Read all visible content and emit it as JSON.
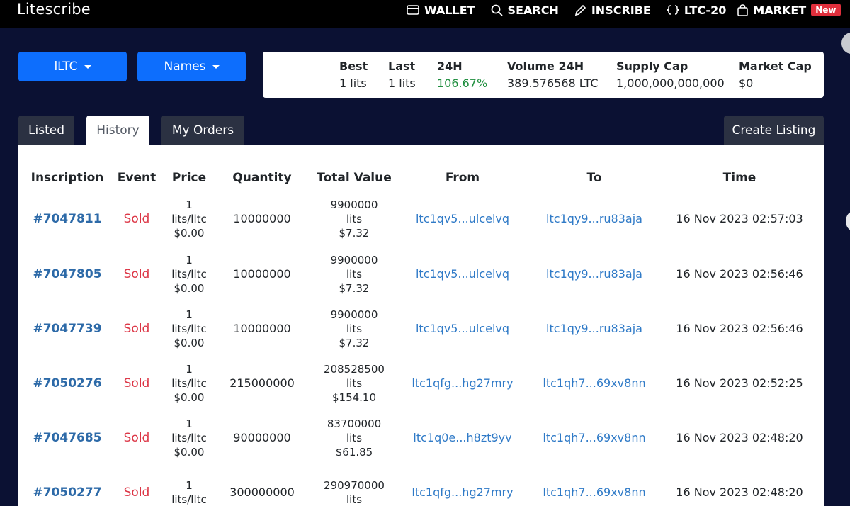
{
  "app": {
    "brand": "Litescribe"
  },
  "nav": {
    "items": [
      {
        "label": "WALLET",
        "icon": "wallet-icon"
      },
      {
        "label": "SEARCH",
        "icon": "search-icon"
      },
      {
        "label": "INSCRIBE",
        "icon": "pencil-icon"
      },
      {
        "label": "LTC-20",
        "icon": "braces-icon"
      },
      {
        "label": "MARKET",
        "icon": "bag-icon",
        "badge": "New"
      }
    ]
  },
  "filters": {
    "token": "lLTC",
    "type": "Names"
  },
  "stats": {
    "best": {
      "label": "Best",
      "value": "1 lits"
    },
    "last": {
      "label": "Last",
      "value": "1 lits"
    },
    "change": {
      "label": "24H",
      "value": "106.67%"
    },
    "volume": {
      "label": "Volume 24H",
      "value": "389.576568 LTC"
    },
    "supply": {
      "label": "Supply Cap",
      "value": "1,000,000,000,000"
    },
    "mcap": {
      "label": "Market Cap",
      "value": "$0"
    }
  },
  "tabs": [
    {
      "label": "Listed"
    },
    {
      "label": "History"
    },
    {
      "label": "My Orders"
    }
  ],
  "actions": {
    "create_listing": "Create Listing"
  },
  "table": {
    "headers": [
      "Inscription",
      "Event",
      "Price",
      "Quantity",
      "Total Value",
      "From",
      "To",
      "Time"
    ],
    "rows": [
      {
        "inscription": "#7047811",
        "event": "Sold",
        "price": "1",
        "price_unit": "lits/lltc",
        "price_usd": "$0.00",
        "quantity": "10000000",
        "total": "9900000",
        "total_unit": "lits",
        "total_usd": "$7.32",
        "from": "ltc1qv5...ulcelvq",
        "to": "ltc1qy9...ru83aja",
        "time": "16 Nov 2023 02:57:03"
      },
      {
        "inscription": "#7047805",
        "event": "Sold",
        "price": "1",
        "price_unit": "lits/lltc",
        "price_usd": "$0.00",
        "quantity": "10000000",
        "total": "9900000",
        "total_unit": "lits",
        "total_usd": "$7.32",
        "from": "ltc1qv5...ulcelvq",
        "to": "ltc1qy9...ru83aja",
        "time": "16 Nov 2023 02:56:46"
      },
      {
        "inscription": "#7047739",
        "event": "Sold",
        "price": "1",
        "price_unit": "lits/lltc",
        "price_usd": "$0.00",
        "quantity": "10000000",
        "total": "9900000",
        "total_unit": "lits",
        "total_usd": "$7.32",
        "from": "ltc1qv5...ulcelvq",
        "to": "ltc1qy9...ru83aja",
        "time": "16 Nov 2023 02:56:46"
      },
      {
        "inscription": "#7050276",
        "event": "Sold",
        "price": "1",
        "price_unit": "lits/lltc",
        "price_usd": "$0.00",
        "quantity": "215000000",
        "total": "208528500",
        "total_unit": "lits",
        "total_usd": "$154.10",
        "from": "ltc1qfg...hg27mry",
        "to": "ltc1qh7...69xv8nn",
        "time": "16 Nov 2023 02:52:25"
      },
      {
        "inscription": "#7047685",
        "event": "Sold",
        "price": "1",
        "price_unit": "lits/lltc",
        "price_usd": "$0.00",
        "quantity": "90000000",
        "total": "83700000",
        "total_unit": "lits",
        "total_usd": "$61.85",
        "from": "ltc1q0e...h8zt9yv",
        "to": "ltc1qh7...69xv8nn",
        "time": "16 Nov 2023 02:48:20"
      },
      {
        "inscription": "#7050277",
        "event": "Sold",
        "price": "1",
        "price_unit": "lits/lltc",
        "price_usd": "",
        "quantity": "300000000",
        "total": "290970000",
        "total_unit": "lits",
        "total_usd": "",
        "from": "ltc1qfg...hg27mry",
        "to": "ltc1qh7...69xv8nn",
        "time": "16 Nov 2023 02:48:20"
      }
    ]
  },
  "colors": {
    "background": "#0b1133",
    "primary": "#0d6efd",
    "positive": "#1e8e3e",
    "sold": "#dc3545",
    "link": "#2f7ac7"
  }
}
